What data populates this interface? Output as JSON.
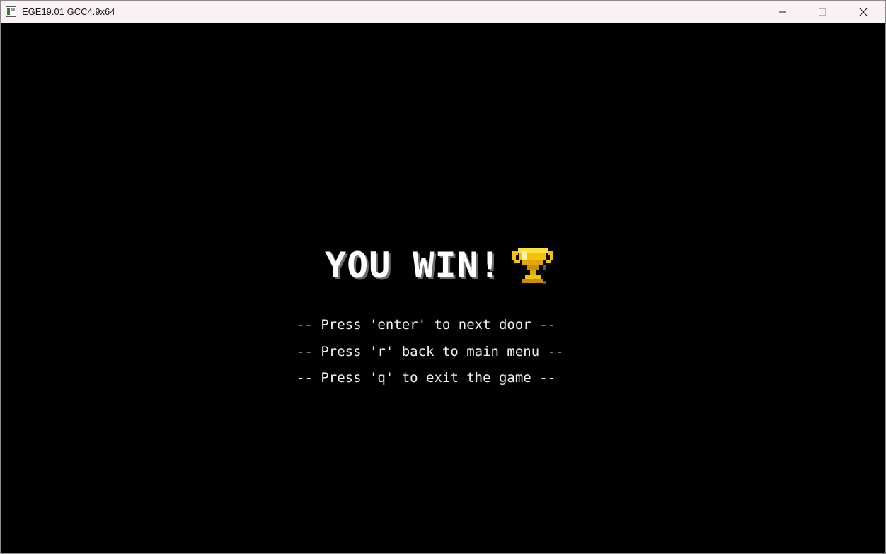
{
  "window": {
    "title": "EGE19.01 GCC4.9x64",
    "controls": {
      "minimize_icon": "minimize-icon",
      "maximize_icon": "maximize-icon",
      "close_icon": "close-icon"
    }
  },
  "game": {
    "heading": "YOU WIN!",
    "heading_icon": "trophy-icon",
    "menu_lines": [
      "-- Press 'enter' to next door --",
      "-- Press 'r' back to main menu --",
      "-- Press 'q' to exit the game --"
    ]
  },
  "colors": {
    "background": "#000000",
    "text": "#ffffff",
    "trophy": "#f4c20d",
    "titlebar": "#f9f1f3"
  }
}
